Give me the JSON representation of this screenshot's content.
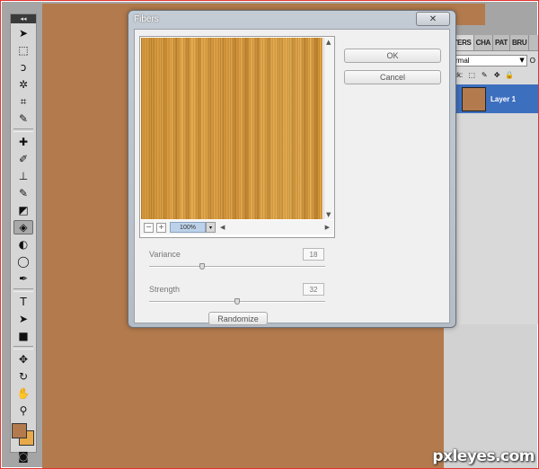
{
  "dialog": {
    "title": "Fibers",
    "close_glyph": "✕",
    "ok_label": "OK",
    "cancel_label": "Cancel",
    "zoom": {
      "minus": "−",
      "plus": "+",
      "value": "100%",
      "caret": "▾"
    },
    "scroll": {
      "up": "▲",
      "down": "▼",
      "left": "◀",
      "right": "▶"
    },
    "params": [
      {
        "label": "Variance",
        "value": "18",
        "slider_fraction": 0.3
      },
      {
        "label": "Strength",
        "value": "32",
        "slider_fraction": 0.5
      }
    ],
    "randomize_label": "Randomize"
  },
  "layers_panel": {
    "tabs": [
      "YERS",
      "CHA",
      "PAT",
      "BRU"
    ],
    "blend_mode": "rmal",
    "blend_caret": "▼",
    "opacity_label": "O",
    "lock_label": "ck:",
    "lock_icons": [
      "⬚",
      "✎",
      "✥",
      "🔒"
    ],
    "layer_name": "Layer 1"
  },
  "toolbox": {
    "collapse": "◂◂",
    "tools": [
      {
        "name": "move-tool",
        "glyph": "➤"
      },
      {
        "name": "marquee-tool",
        "glyph": "⬚"
      },
      {
        "name": "lasso-tool",
        "glyph": "ↄ"
      },
      {
        "name": "quick-select-tool",
        "glyph": "✲"
      },
      {
        "name": "crop-tool",
        "glyph": "⌗"
      },
      {
        "name": "eyedropper-tool",
        "glyph": "✎"
      },
      {
        "name": "healing-brush-tool",
        "glyph": "✚"
      },
      {
        "name": "brush-tool",
        "glyph": "✐"
      },
      {
        "name": "clone-stamp-tool",
        "glyph": "⊥"
      },
      {
        "name": "history-brush-tool",
        "glyph": "✎"
      },
      {
        "name": "eraser-tool",
        "glyph": "◩"
      },
      {
        "name": "paint-bucket-tool",
        "glyph": "◈"
      },
      {
        "name": "blur-tool",
        "glyph": "◐"
      },
      {
        "name": "dodge-tool",
        "glyph": "◯"
      },
      {
        "name": "pen-tool",
        "glyph": "✒"
      },
      {
        "name": "type-tool",
        "glyph": "T"
      },
      {
        "name": "path-select-tool",
        "glyph": "➤"
      },
      {
        "name": "shape-tool",
        "glyph": "■"
      },
      {
        "name": "3d-rotate-tool",
        "glyph": "✥"
      },
      {
        "name": "3d-orbit-tool",
        "glyph": "↻"
      },
      {
        "name": "hand-tool",
        "glyph": "✋"
      },
      {
        "name": "zoom-tool",
        "glyph": "⚲"
      }
    ],
    "active_tool": "paint-bucket-tool",
    "foreground_color": "#b37b4d",
    "background_color": "#e8a94a",
    "quick_mask_glyph": "◙"
  },
  "canvas_color": "#b37b4d",
  "watermark": "pxleyes.com"
}
